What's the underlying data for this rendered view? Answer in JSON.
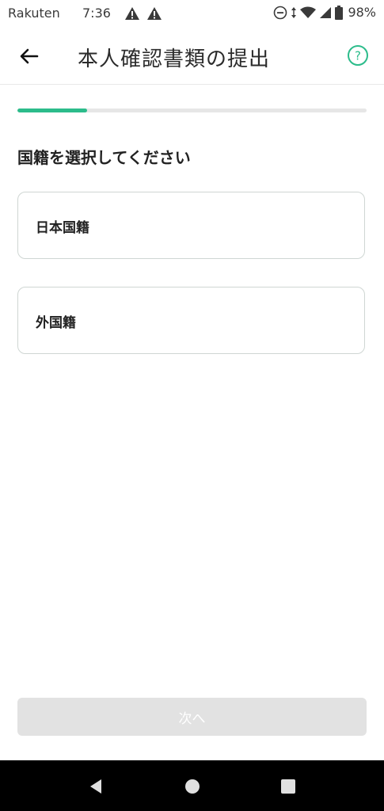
{
  "status_bar": {
    "carrier": "Rakuten",
    "time": "7:36",
    "battery_percent": "98%"
  },
  "app_bar": {
    "title": "本人確認書類の提出",
    "back_icon": "arrow-left-icon",
    "help_icon": "question-circle-icon"
  },
  "progress": {
    "fraction": 0.2
  },
  "prompt": "国籍を選択してください",
  "options": [
    {
      "label": "日本国籍"
    },
    {
      "label": "外国籍"
    }
  ],
  "next_button": {
    "label": "次へ",
    "enabled": false
  },
  "nav_bar": {
    "icons": [
      "nav-back-icon",
      "nav-home-icon",
      "nav-recents-icon"
    ]
  },
  "colors": {
    "accent": "#2cbc8b",
    "disabled_button": "#e2e2e2",
    "border": "#cfd6d3"
  }
}
